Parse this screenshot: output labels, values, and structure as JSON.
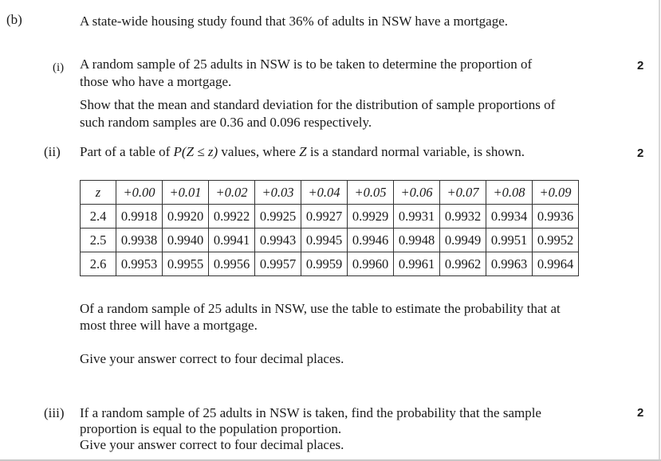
{
  "part_label": "(b)",
  "intro": "A state-wide housing study found that 36% of adults in NSW have a mortgage.",
  "q1": {
    "label": "(i)",
    "line1": "A random sample of 25 adults in NSW is to be taken to determine the proportion of",
    "line2": "those who have a mortgage.",
    "line3": "Show that the mean and standard deviation for the distribution of sample proportions of",
    "line4": "such random samples are 0.36 and 0.096 respectively.",
    "marks": "2"
  },
  "q2": {
    "label": "(ii)",
    "line1_a": "Part of a table of ",
    "line1_math": "P(Z ≤ z)",
    "line1_b": " values, where ",
    "line1_Z": "Z",
    "line1_c": " is a standard normal variable, is shown.",
    "marks": "2",
    "line2": "Of a random sample of 25 adults in NSW, use the table to estimate the probability that at",
    "line3": "most three will have a mortgage.",
    "line4": "Give your answer correct to four decimal places."
  },
  "table": {
    "header": [
      "z",
      "+0.00",
      "+0.01",
      "+0.02",
      "+0.03",
      "+0.04",
      "+0.05",
      "+0.06",
      "+0.07",
      "+0.08",
      "+0.09"
    ],
    "rows": [
      [
        "2.4",
        "0.9918",
        "0.9920",
        "0.9922",
        "0.9925",
        "0.9927",
        "0.9929",
        "0.9931",
        "0.9932",
        "0.9934",
        "0.9936"
      ],
      [
        "2.5",
        "0.9938",
        "0.9940",
        "0.9941",
        "0.9943",
        "0.9945",
        "0.9946",
        "0.9948",
        "0.9949",
        "0.9951",
        "0.9952"
      ],
      [
        "2.6",
        "0.9953",
        "0.9955",
        "0.9956",
        "0.9957",
        "0.9959",
        "0.9960",
        "0.9961",
        "0.9962",
        "0.9963",
        "0.9964"
      ]
    ]
  },
  "q3": {
    "label": "(iii)",
    "line1": "If a random sample of 25 adults in NSW is taken, find the probability that the sample",
    "line2": "proportion is equal to the population proportion.",
    "line3": "Give your answer correct to four decimal places.",
    "marks": "2"
  }
}
